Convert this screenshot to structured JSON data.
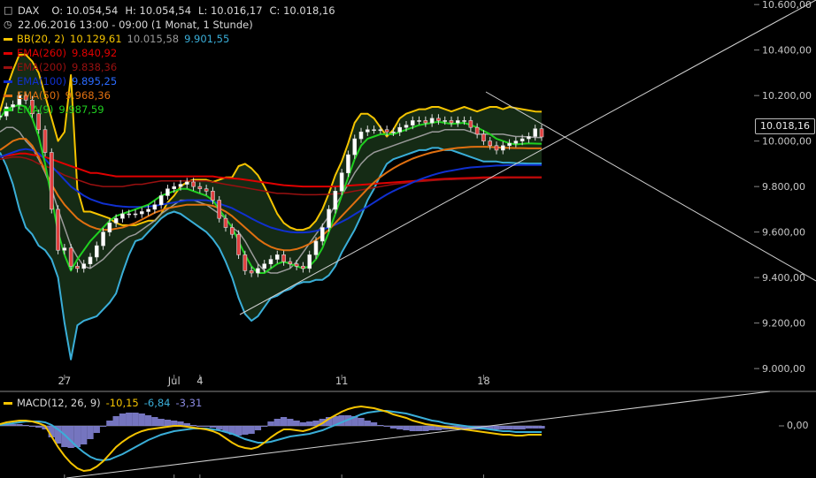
{
  "header": {
    "symbol_icon": "candlestick-icon",
    "symbol": "DAX",
    "ohlc": [
      {
        "label": "O:",
        "value": "10.054,54"
      },
      {
        "label": "H:",
        "value": "10.054,54"
      },
      {
        "label": "L:",
        "value": "10.016,17"
      },
      {
        "label": "C:",
        "value": "10.018,16"
      }
    ],
    "period_icon": "clock-icon",
    "period": "22.06.2016 13:00 - 09:00 (1 Monat, 1 Stunde)"
  },
  "legend": [
    {
      "label": "BB(20, 2)",
      "color": "#f5c400",
      "values": [
        "10.129,61",
        "10.015,58",
        "9.901,55"
      ],
      "value_colors": [
        "#f5c400",
        "#9a9a9a",
        "#3aaed8"
      ]
    },
    {
      "label": "EMA(260)",
      "color": "#e00000",
      "values": [
        "9.840,92"
      ],
      "value_colors": [
        "#e00000"
      ]
    },
    {
      "label": "EMA(200)",
      "color": "#9a1010",
      "values": [
        "9.838,36"
      ],
      "value_colors": [
        "#9a1010"
      ]
    },
    {
      "label": "EMA(100)",
      "color": "#1030d0",
      "values": [
        "9.895,25"
      ],
      "value_colors": [
        "#2b6bff"
      ]
    },
    {
      "label": "EMA(50)",
      "color": "#e07010",
      "values": [
        "9.968,36"
      ],
      "value_colors": [
        "#e07010"
      ]
    },
    {
      "label": "EMA(9)",
      "color": "#20d020",
      "values": [
        "9.987,59"
      ],
      "value_colors": [
        "#20d020"
      ]
    }
  ],
  "last_price": "10.018,16",
  "macd": {
    "label": "MACD(12, 26, 9)",
    "color": "#f5c400",
    "values": [
      "-10,15",
      "-6,84",
      "-3,31"
    ],
    "value_colors": [
      "#f5c400",
      "#3aaed8",
      "#8a8ae0"
    ],
    "zero_label": "0,00"
  },
  "chart_data": {
    "type": "line",
    "title": "",
    "xlabel": "",
    "ylabel": "",
    "y_ticks": [
      "9.000,00",
      "9.200,00",
      "9.400,00",
      "9.600,00",
      "9.800,00",
      "10.000,00",
      "10.200,00",
      "10.400,00",
      "10.600,00"
    ],
    "y_tick_values": [
      9000,
      9200,
      9400,
      9600,
      9800,
      10000,
      10200,
      10400,
      10600
    ],
    "ylim": [
      8950,
      10620
    ],
    "x_ticks": [
      "27",
      "Jul",
      "4",
      "11",
      "18"
    ],
    "x_tick_index": [
      10,
      27,
      31,
      53,
      75
    ],
    "grid": false,
    "series": [
      {
        "name": "BB(20, 2)",
        "color": "#f5c400",
        "values": [
          10130,
          10230,
          10310,
          10380,
          10380,
          10350,
          10300,
          10200,
          10100,
          10000,
          10040,
          10290,
          9790,
          9690,
          9690,
          9680,
          9670,
          9660,
          9640,
          9630,
          9630,
          9630,
          9640,
          9650,
          9650,
          9680,
          9730,
          9760,
          9800,
          9820,
          9830,
          9830,
          9830,
          9820,
          9830,
          9840,
          9840,
          9890,
          9900,
          9880,
          9850,
          9800,
          9740,
          9680,
          9640,
          9620,
          9610,
          9610,
          9620,
          9650,
          9700,
          9770,
          9850,
          9910,
          9990,
          10080,
          10120,
          10120,
          10100,
          10060,
          10020,
          10050,
          10100,
          10120,
          10130,
          10140,
          10140,
          10150,
          10150,
          10140,
          10130,
          10140,
          10150,
          10140,
          10130,
          10140,
          10150,
          10150,
          10140,
          10150,
          10145,
          10140,
          10135,
          10130,
          10129
        ]
      },
      {
        "name": "BB middle",
        "color": "#9a9a9a",
        "values": [
          10040,
          10060,
          10060,
          10040,
          10000,
          9970,
          9920,
          9860,
          9790,
          9700,
          9620,
          9540,
          9490,
          9450,
          9440,
          9460,
          9480,
          9510,
          9540,
          9560,
          9580,
          9590,
          9610,
          9630,
          9650,
          9680,
          9700,
          9720,
          9740,
          9740,
          9740,
          9730,
          9720,
          9700,
          9680,
          9660,
          9620,
          9600,
          9560,
          9510,
          9460,
          9430,
          9420,
          9420,
          9430,
          9440,
          9470,
          9510,
          9550,
          9590,
          9630,
          9670,
          9720,
          9760,
          9810,
          9860,
          9900,
          9930,
          9950,
          9960,
          9970,
          9980,
          9990,
          10000,
          10010,
          10020,
          10030,
          10040,
          10040,
          10050,
          10050,
          10050,
          10050,
          10040,
          10030,
          10030,
          10030,
          10030,
          10030,
          10025,
          10020,
          10020,
          10018,
          10016,
          10015
        ]
      },
      {
        "name": "BB lower",
        "color": "#3aaed8",
        "values": [
          9950,
          9890,
          9810,
          9700,
          9620,
          9590,
          9540,
          9520,
          9480,
          9400,
          9200,
          9040,
          9190,
          9210,
          9220,
          9230,
          9260,
          9290,
          9330,
          9420,
          9500,
          9560,
          9570,
          9600,
          9630,
          9660,
          9680,
          9690,
          9680,
          9660,
          9640,
          9620,
          9600,
          9570,
          9530,
          9470,
          9400,
          9310,
          9240,
          9210,
          9230,
          9270,
          9310,
          9320,
          9340,
          9350,
          9370,
          9380,
          9380,
          9390,
          9390,
          9410,
          9450,
          9510,
          9560,
          9610,
          9670,
          9740,
          9790,
          9850,
          9900,
          9920,
          9930,
          9940,
          9950,
          9960,
          9960,
          9970,
          9970,
          9960,
          9960,
          9950,
          9940,
          9930,
          9920,
          9910,
          9910,
          9910,
          9905,
          9905,
          9903,
          9902,
          9901,
          9901,
          9901
        ]
      },
      {
        "name": "EMA(260)",
        "color": "#e00000",
        "values": [
          9930,
          9935,
          9940,
          9945,
          9945,
          9940,
          9935,
          9930,
          9920,
          9910,
          9900,
          9890,
          9880,
          9870,
          9860,
          9860,
          9855,
          9850,
          9845,
          9845,
          9845,
          9845,
          9845,
          9845,
          9845,
          9845,
          9845,
          9845,
          9845,
          9845,
          9845,
          9845,
          9845,
          9845,
          9840,
          9838,
          9836,
          9834,
          9830,
          9826,
          9822,
          9818,
          9814,
          9810,
          9806,
          9804,
          9802,
          9800,
          9800,
          9800,
          9800,
          9800,
          9800,
          9802,
          9804,
          9806,
          9808,
          9810,
          9812,
          9814,
          9816,
          9818,
          9820,
          9822,
          9824,
          9826,
          9828,
          9830,
          9832,
          9834,
          9835,
          9836,
          9837,
          9838,
          9839,
          9840,
          9840,
          9840,
          9841,
          9841,
          9841,
          9841,
          9841,
          9841,
          9841
        ]
      },
      {
        "name": "EMA(200)",
        "color": "#9a1010",
        "values": [
          9920,
          9925,
          9930,
          9930,
          9925,
          9915,
          9900,
          9890,
          9880,
          9865,
          9850,
          9840,
          9830,
          9820,
          9810,
          9805,
          9800,
          9800,
          9800,
          9800,
          9805,
          9810,
          9810,
          9815,
          9820,
          9825,
          9825,
          9825,
          9825,
          9825,
          9825,
          9825,
          9825,
          9820,
          9815,
          9810,
          9805,
          9800,
          9795,
          9790,
          9785,
          9780,
          9775,
          9770,
          9770,
          9768,
          9766,
          9764,
          9764,
          9764,
          9765,
          9766,
          9768,
          9770,
          9775,
          9780,
          9785,
          9790,
          9795,
          9800,
          9805,
          9810,
          9813,
          9816,
          9820,
          9822,
          9824,
          9826,
          9828,
          9830,
          9831,
          9832,
          9833,
          9834,
          9835,
          9836,
          9836,
          9837,
          9837,
          9838,
          9838,
          9838,
          9838,
          9838,
          9838
        ]
      },
      {
        "name": "EMA(100)",
        "color": "#1030d0",
        "values": [
          9930,
          9940,
          9950,
          9960,
          9965,
          9960,
          9945,
          9920,
          9890,
          9860,
          9830,
          9800,
          9780,
          9760,
          9745,
          9735,
          9725,
          9720,
          9715,
          9712,
          9710,
          9710,
          9710,
          9712,
          9715,
          9720,
          9725,
          9730,
          9735,
          9740,
          9740,
          9740,
          9740,
          9735,
          9725,
          9715,
          9705,
          9690,
          9675,
          9660,
          9645,
          9632,
          9620,
          9612,
          9605,
          9600,
          9598,
          9598,
          9600,
          9605,
          9612,
          9620,
          9632,
          9645,
          9660,
          9678,
          9695,
          9712,
          9730,
          9748,
          9765,
          9780,
          9793,
          9805,
          9818,
          9830,
          9840,
          9850,
          9858,
          9865,
          9870,
          9875,
          9880,
          9884,
          9886,
          9888,
          9890,
          9892,
          9893,
          9894,
          9894,
          9895,
          9895,
          9895,
          9895
        ]
      },
      {
        "name": "EMA(50)",
        "color": "#e07010",
        "values": [
          9960,
          9980,
          10000,
          10010,
          10010,
          9980,
          9930,
          9870,
          9810,
          9760,
          9720,
          9690,
          9660,
          9640,
          9625,
          9615,
          9610,
          9610,
          9615,
          9620,
          9630,
          9640,
          9655,
          9670,
          9685,
          9695,
          9705,
          9710,
          9715,
          9720,
          9720,
          9720,
          9720,
          9715,
          9705,
          9690,
          9670,
          9645,
          9620,
          9595,
          9570,
          9550,
          9535,
          9525,
          9520,
          9520,
          9525,
          9535,
          9548,
          9565,
          9585,
          9610,
          9640,
          9670,
          9700,
          9730,
          9760,
          9790,
          9818,
          9842,
          9862,
          9880,
          9896,
          9910,
          9923,
          9933,
          9942,
          9950,
          9956,
          9962,
          9966,
          9970,
          9972,
          9974,
          9975,
          9975,
          9974,
          9972,
          9971,
          9970,
          9969,
          9969,
          9968,
          9968,
          9968
        ]
      },
      {
        "name": "EMA(9)",
        "color": "#20d020",
        "values": [
          10100,
          10140,
          10150,
          10160,
          10150,
          10100,
          10020,
          9900,
          9750,
          9600,
          9500,
          9430,
          9480,
          9520,
          9560,
          9590,
          9620,
          9650,
          9670,
          9680,
          9690,
          9700,
          9710,
          9720,
          9740,
          9760,
          9770,
          9780,
          9790,
          9790,
          9780,
          9770,
          9760,
          9740,
          9700,
          9660,
          9620,
          9560,
          9500,
          9450,
          9420,
          9420,
          9440,
          9460,
          9470,
          9460,
          9450,
          9440,
          9450,
          9480,
          9530,
          9600,
          9680,
          9760,
          9840,
          9920,
          9980,
          10010,
          10020,
          10030,
          10030,
          10030,
          10040,
          10050,
          10060,
          10070,
          10075,
          10080,
          10085,
          10080,
          10075,
          10078,
          10080,
          10070,
          10060,
          10045,
          10030,
          10010,
          10000,
          9990,
          9985,
          9988,
          9990,
          9989,
          9988
        ]
      },
      {
        "name": "DAX",
        "color": "#eaeaea",
        "values": [
          10110,
          10150,
          10160,
          10200,
          10180,
          10120,
          10050,
          9950,
          9700,
          9520,
          9530,
          9450,
          9440,
          9460,
          9490,
          9540,
          9600,
          9640,
          9660,
          9680,
          9680,
          9680,
          9690,
          9700,
          9720,
          9760,
          9790,
          9800,
          9810,
          9820,
          9800,
          9790,
          9780,
          9740,
          9660,
          9620,
          9590,
          9500,
          9430,
          9420,
          9440,
          9460,
          9480,
          9500,
          9470,
          9460,
          9450,
          9440,
          9500,
          9560,
          9620,
          9700,
          9780,
          9860,
          9940,
          10010,
          10040,
          10050,
          10050,
          10050,
          10040,
          10040,
          10060,
          10070,
          10090,
          10090,
          10080,
          10100,
          10090,
          10090,
          10080,
          10090,
          10090,
          10060,
          10030,
          10000,
          9980,
          9960,
          9980,
          9990,
          10000,
          10010,
          10020,
          10054,
          10018
        ]
      }
    ],
    "macd_series": [
      {
        "name": "MACD",
        "color": "#f5c400",
        "values": [
          2,
          4,
          5,
          6,
          6,
          5,
          3,
          0,
          -12,
          -24,
          -34,
          -42,
          -48,
          -51,
          -50,
          -46,
          -40,
          -32,
          -24,
          -18,
          -13,
          -9,
          -6,
          -4,
          -3,
          -2,
          -1,
          0,
          0,
          -1,
          -2,
          -3,
          -4,
          -6,
          -9,
          -14,
          -19,
          -23,
          -25,
          -26,
          -24,
          -19,
          -13,
          -8,
          -4,
          -4,
          -5,
          -6,
          -4,
          -1,
          3,
          8,
          12,
          16,
          19,
          21,
          22,
          21,
          20,
          18,
          16,
          13,
          11,
          9,
          6,
          4,
          2,
          1,
          0,
          -1,
          -2,
          -3,
          -4,
          -5,
          -6,
          -7,
          -8,
          -9,
          -10,
          -10,
          -11,
          -11,
          -10,
          -10,
          -10
        ]
      },
      {
        "name": "Signal",
        "color": "#3aaed8",
        "values": [
          1,
          2,
          3,
          4,
          5,
          5,
          5,
          4,
          1,
          -4,
          -10,
          -17,
          -24,
          -30,
          -35,
          -38,
          -39,
          -38,
          -35,
          -32,
          -28,
          -24,
          -20,
          -16,
          -13,
          -10,
          -8,
          -6,
          -5,
          -4,
          -3,
          -3,
          -3,
          -4,
          -5,
          -7,
          -9,
          -12,
          -15,
          -17,
          -19,
          -19,
          -18,
          -16,
          -14,
          -12,
          -11,
          -10,
          -9,
          -7,
          -5,
          -2,
          1,
          4,
          7,
          10,
          13,
          15,
          16,
          17,
          17,
          16,
          15,
          14,
          12,
          10,
          8,
          6,
          5,
          3,
          2,
          1,
          0,
          -1,
          -2,
          -3,
          -4,
          -5,
          -6,
          -6,
          -7,
          -7,
          -7,
          -7,
          -7
        ]
      },
      {
        "name": "Histogram",
        "color": "#8a8ae0",
        "values": [
          1,
          2,
          2,
          2,
          1,
          0,
          -2,
          -4,
          -13,
          -20,
          -24,
          -25,
          -24,
          -21,
          -15,
          -8,
          -1,
          6,
          11,
          14,
          15,
          15,
          14,
          12,
          10,
          8,
          7,
          6,
          5,
          3,
          1,
          0,
          -1,
          -2,
          -4,
          -7,
          -10,
          -11,
          -10,
          -9,
          -5,
          0,
          5,
          8,
          10,
          8,
          6,
          4,
          5,
          6,
          8,
          10,
          11,
          12,
          12,
          11,
          9,
          6,
          4,
          1,
          -1,
          -3,
          -4,
          -5,
          -6,
          -6,
          -6,
          -5,
          -5,
          -4,
          -4,
          -4,
          -4,
          -4,
          -4,
          -4,
          -4,
          -4,
          -4,
          -4,
          -4,
          -4,
          -3,
          -3,
          -3
        ]
      }
    ]
  }
}
